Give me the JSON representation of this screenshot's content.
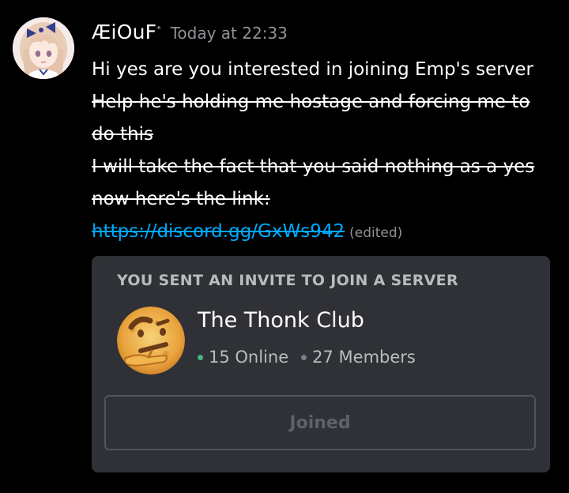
{
  "message": {
    "author": "ÆiOuF",
    "author_badge": "ᵉ",
    "timestamp": "Today at 22:33",
    "lines": [
      "Hi yes are you interested in joining Emp's server",
      "Help he's holding me hostage and forcing me to",
      "do this",
      "I will take the fact that you said nothing as a yes",
      "now here's the link:"
    ],
    "link": "https://discord.gg/GxWs942",
    "edited": "(edited)"
  },
  "invite": {
    "heading": "YOU SENT AN INVITE TO JOIN A SERVER",
    "server_name": "The Thonk Club",
    "online": "15 Online",
    "members": "27 Members",
    "button_label": "Joined"
  },
  "colors": {
    "background": "#000000",
    "link": "#00a8fc",
    "muted": "#8e9297",
    "card": "#2f3136",
    "online_dot": "#43b581"
  },
  "icons": {
    "avatar": "anime-girl-avatar",
    "server": "thinking-face-emoji"
  }
}
